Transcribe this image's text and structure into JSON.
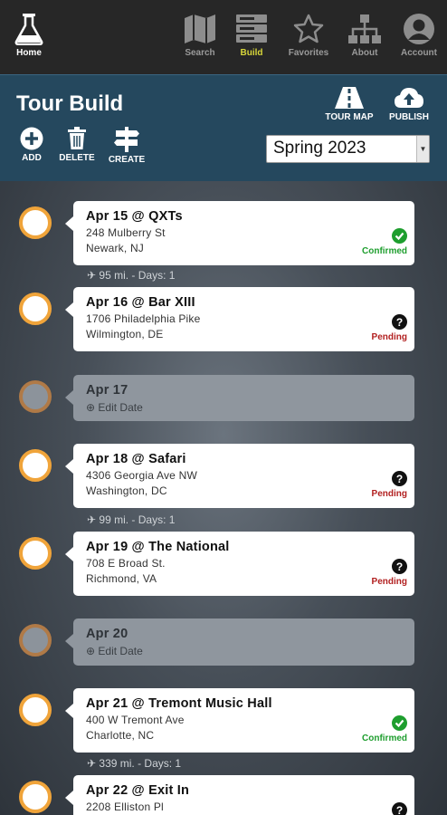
{
  "nav": {
    "home": "Home",
    "search": "Search",
    "build": "Build",
    "favorites": "Favorites",
    "about": "About",
    "account": "Account"
  },
  "header": {
    "title": "Tour Build",
    "tour_map": "TOUR MAP",
    "publish": "PUBLISH",
    "add": "ADD",
    "delete": "DELETE",
    "create": "CREATE",
    "season_selected": "Spring 2023"
  },
  "colors": {
    "nav_active": "#d7d63a",
    "header_bg": "#25485e",
    "dot_border": "#f0a43a",
    "confirmed": "#1e9e2e",
    "pending": "#b22020"
  },
  "tour": [
    {
      "title": "Apr 15 @ QXTs",
      "address": "248 Mulberry St",
      "city": "Newark, NJ",
      "status": "Confirmed"
    },
    {
      "distance": "95 mi. - Days: 1"
    },
    {
      "title": "Apr 16 @ Bar XIII",
      "address": "1706 Philadelphia Pike",
      "city": "Wilmington, DE",
      "status": "Pending"
    },
    {
      "title": "Apr 17",
      "edit": "Edit Date"
    },
    {
      "title": "Apr 18 @ Safari",
      "address": "4306 Georgia Ave NW",
      "city": "Washington, DC",
      "status": "Pending"
    },
    {
      "distance": "99 mi. - Days: 1"
    },
    {
      "title": "Apr 19 @ The National",
      "address": "708 E Broad St.",
      "city": "Richmond, VA",
      "status": "Pending"
    },
    {
      "title": "Apr 20",
      "edit": "Edit Date"
    },
    {
      "title": "Apr 21 @ Tremont Music Hall",
      "address": "400 W Tremont Ave",
      "city": "Charlotte, NC",
      "status": "Confirmed"
    },
    {
      "distance": "339 mi. - Days: 1"
    },
    {
      "title": "Apr 22 @ Exit In",
      "address": "2208 Elliston Pl"
    }
  ]
}
